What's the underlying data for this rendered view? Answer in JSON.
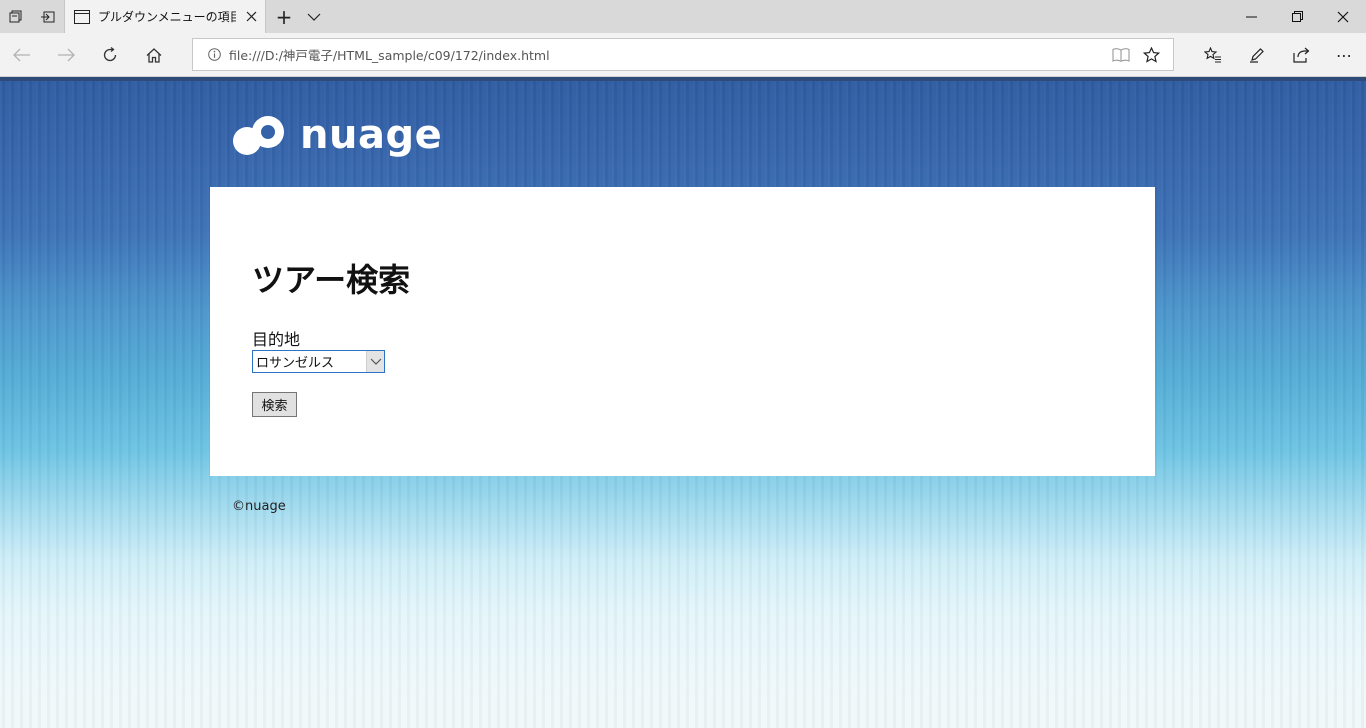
{
  "browser": {
    "tab_title": "プルダウンメニューの項目を",
    "address": "file:///D:/神戸電子/HTML_sample/c09/172/index.html",
    "new_tab_glyph": "+",
    "tab_list_glyph": "⌵",
    "menu_glyph": "⋯"
  },
  "icons": [
    "tab-manager-icon",
    "set-aside-icon",
    "page-icon",
    "close-icon",
    "plus-icon",
    "chevron-down-icon",
    "minimize-icon",
    "restore-icon",
    "window-close-icon",
    "back-icon",
    "forward-icon",
    "refresh-icon",
    "home-icon",
    "info-icon",
    "reading-view-icon",
    "star-icon",
    "favorites-icon",
    "pen-icon",
    "share-icon",
    "more-icon"
  ],
  "site": {
    "logo_text": "nuage",
    "footer": "©nuage"
  },
  "form": {
    "heading": "ツアー検索",
    "destination_label": "目的地",
    "destination_value": "ロサンゼルス",
    "search_button": "検索"
  }
}
